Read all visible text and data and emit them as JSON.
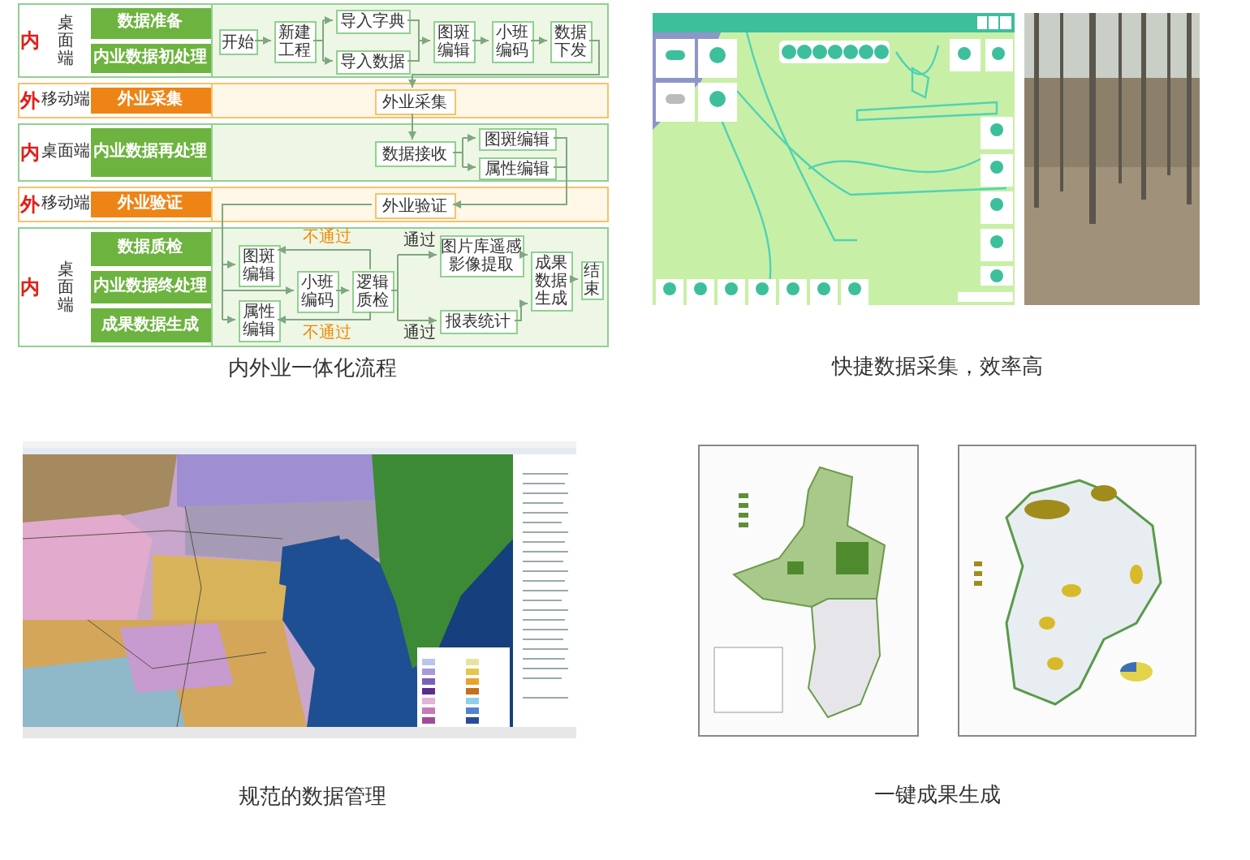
{
  "flowchart": {
    "caption": "内外业一体化流程",
    "lanes": [
      {
        "side": "内",
        "kind": "office",
        "platform": "桌面端",
        "stages": [
          "数据准备",
          "内业数据初处理"
        ],
        "nodes": [
          "开始",
          "新建工程",
          "导入字典",
          "导入数据",
          "图斑编辑",
          "小班编码",
          "数据下发"
        ]
      },
      {
        "side": "外",
        "kind": "field",
        "platform": "移动端",
        "stages": [
          "外业采集"
        ],
        "nodes": [
          "外业采集"
        ]
      },
      {
        "side": "内",
        "kind": "office",
        "platform": "桌面端",
        "stages": [
          "内业数据再处理"
        ],
        "nodes": [
          "数据接收",
          "图斑编辑",
          "属性编辑"
        ]
      },
      {
        "side": "外",
        "kind": "field",
        "platform": "移动端",
        "stages": [
          "外业验证"
        ],
        "nodes": [
          "外业验证"
        ]
      },
      {
        "side": "内",
        "kind": "office",
        "platform": "桌面端",
        "stages": [
          "数据质检",
          "内业数据终处理",
          "成果数据生成"
        ],
        "nodes": [
          "图斑编辑",
          "属性编辑",
          "小班编码",
          "逻辑质检",
          "图片库遥感影像提取",
          "报表统计",
          "成果数据生成",
          "结束"
        ],
        "edge_labels": [
          {
            "text": "不通过",
            "kind": "fail"
          },
          {
            "text": "不通过",
            "kind": "fail"
          },
          {
            "text": "通过",
            "kind": "pass"
          },
          {
            "text": "通过",
            "kind": "pass"
          }
        ]
      }
    ]
  },
  "data_collection": {
    "caption": "快捷数据采集，效率高"
  },
  "data_management": {
    "caption": "规范的数据管理"
  },
  "output_maps": {
    "caption": "一键成果生成"
  }
}
